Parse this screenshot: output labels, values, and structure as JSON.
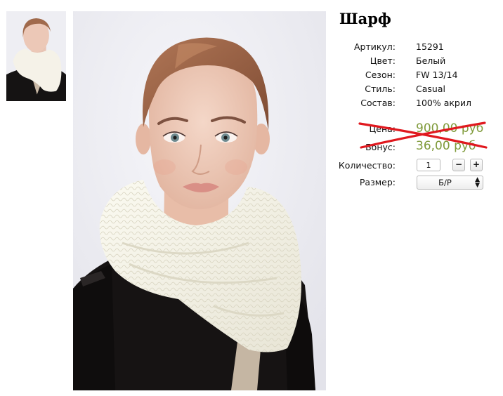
{
  "product": {
    "title": "Шарф",
    "attributes": [
      {
        "label": "Артикул:",
        "value": "15291"
      },
      {
        "label": "Цвет:",
        "value": "Белый"
      },
      {
        "label": "Сезон:",
        "value": "FW 13/14"
      },
      {
        "label": "Стиль:",
        "value": "Casual"
      },
      {
        "label": "Состав:",
        "value": "100% акрил"
      }
    ],
    "price": {
      "label": "Цена:",
      "value": "900,00 руб"
    },
    "bonus": {
      "label": "Бонус:",
      "value": "36,00 руб"
    },
    "price_color": "#7f9a3a",
    "cross_color": "#e0181e",
    "quantity": {
      "label": "Количество:",
      "value": "1",
      "minus": "−",
      "plus": "+"
    },
    "size": {
      "label": "Размер:",
      "selected": "Б/Р"
    }
  }
}
